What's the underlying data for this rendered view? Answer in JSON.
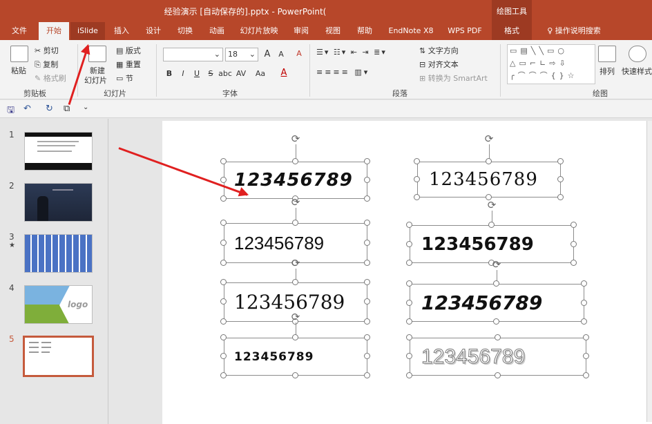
{
  "window": {
    "title": "经验演示 [自动保存的].pptx  -  PowerPoint(",
    "context_tab_group": "绘图工具"
  },
  "tabs": [
    "文件",
    "开始",
    "iSlide",
    "插入",
    "设计",
    "切换",
    "动画",
    "幻灯片放映",
    "审阅",
    "视图",
    "帮助",
    "EndNote X8",
    "WPS PDF",
    "格式"
  ],
  "tell_me": "操作说明搜索",
  "ribbon": {
    "clipboard": {
      "paste": "粘贴",
      "cut": "剪切",
      "copy": "复制",
      "format_painter": "格式刷",
      "label": "剪贴板"
    },
    "slides": {
      "new_slide": "新建",
      "new_slide2": "幻灯片",
      "layout": "版式",
      "reset": "重置",
      "section": "节",
      "label": "幻灯片"
    },
    "font": {
      "font_name": "",
      "font_size": "18",
      "bold": "B",
      "italic": "I",
      "underline": "U",
      "strike": "S",
      "shadow": "abc",
      "spacing": "AV",
      "case": "Aa",
      "grow": "A",
      "shrink": "A",
      "clear": "A",
      "color": "A",
      "label": "字体"
    },
    "paragraph": {
      "text_direction": "文字方向",
      "align_text": "对齐文本",
      "smartart": "转换为 SmartArt",
      "label": "段落"
    },
    "drawing": {
      "arrange": "排列",
      "quick_styles": "快速样式",
      "label": "绘图"
    }
  },
  "slides": [
    {
      "number": "1",
      "marker": ""
    },
    {
      "number": "2",
      "marker": ""
    },
    {
      "number": "3",
      "marker": "★"
    },
    {
      "number": "4",
      "marker": "",
      "logo": "logo"
    },
    {
      "number": "5",
      "marker": ""
    }
  ],
  "textboxes": [
    {
      "text": "123456789",
      "style": "script"
    },
    {
      "text": "123456789",
      "style": "serif-ornate"
    },
    {
      "text": "123456789",
      "style": "sans"
    },
    {
      "text": "123456789",
      "style": "bold-rounded"
    },
    {
      "text": "123456789",
      "style": "serif"
    },
    {
      "text": "123456789",
      "style": "brush-bold"
    },
    {
      "text": "123456789",
      "style": "bold-small"
    },
    {
      "text": "123456789",
      "style": "outline"
    }
  ],
  "colors": {
    "accent": "#b7472a",
    "arrow": "#e02020"
  }
}
